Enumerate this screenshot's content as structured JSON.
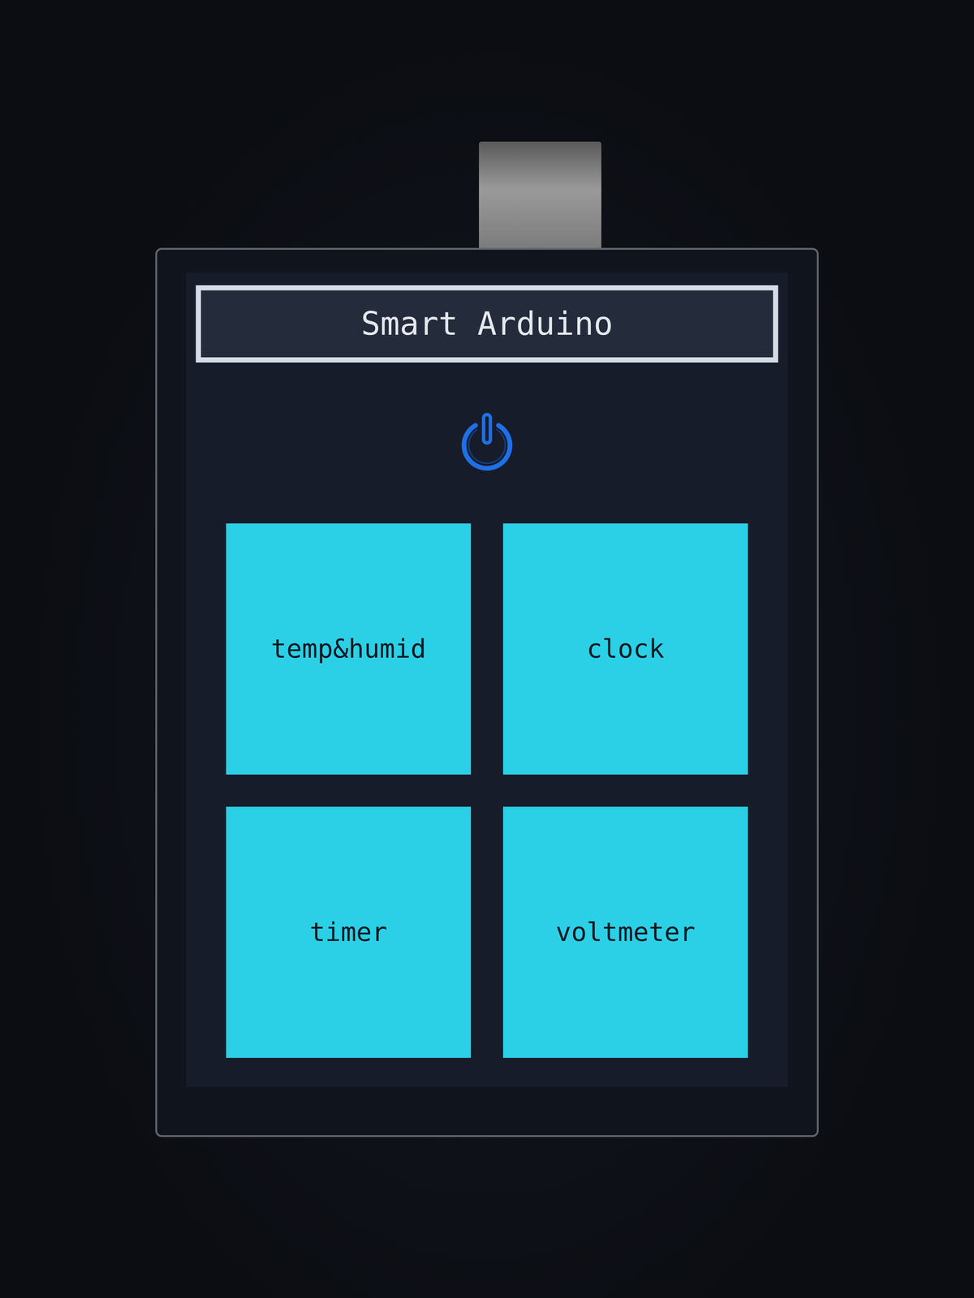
{
  "header": {
    "title": "Smart Arduino"
  },
  "tiles": [
    {
      "label": "temp&humid"
    },
    {
      "label": "clock"
    },
    {
      "label": "timer"
    },
    {
      "label": "voltmeter"
    }
  ]
}
